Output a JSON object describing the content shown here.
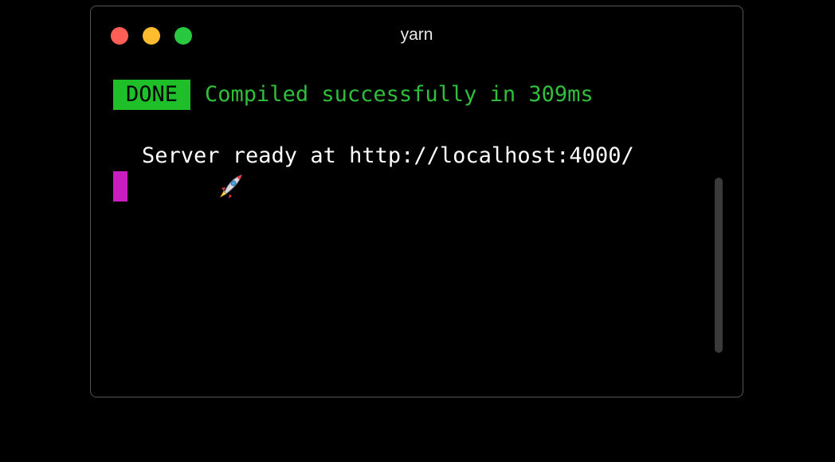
{
  "window": {
    "title": "yarn"
  },
  "terminal": {
    "badge": "DONE",
    "compiled_message": "Compiled successfully in 309ms",
    "server_message": "Server ready at http://localhost:4000/",
    "rocket_icon": "rocket-icon"
  },
  "colors": {
    "badge_bg": "#1fbf2a",
    "success_text": "#2fbf3a",
    "cursor": "#c81ec0",
    "close": "#ff5f57",
    "minimize": "#febc2e",
    "maximize": "#28c840"
  }
}
